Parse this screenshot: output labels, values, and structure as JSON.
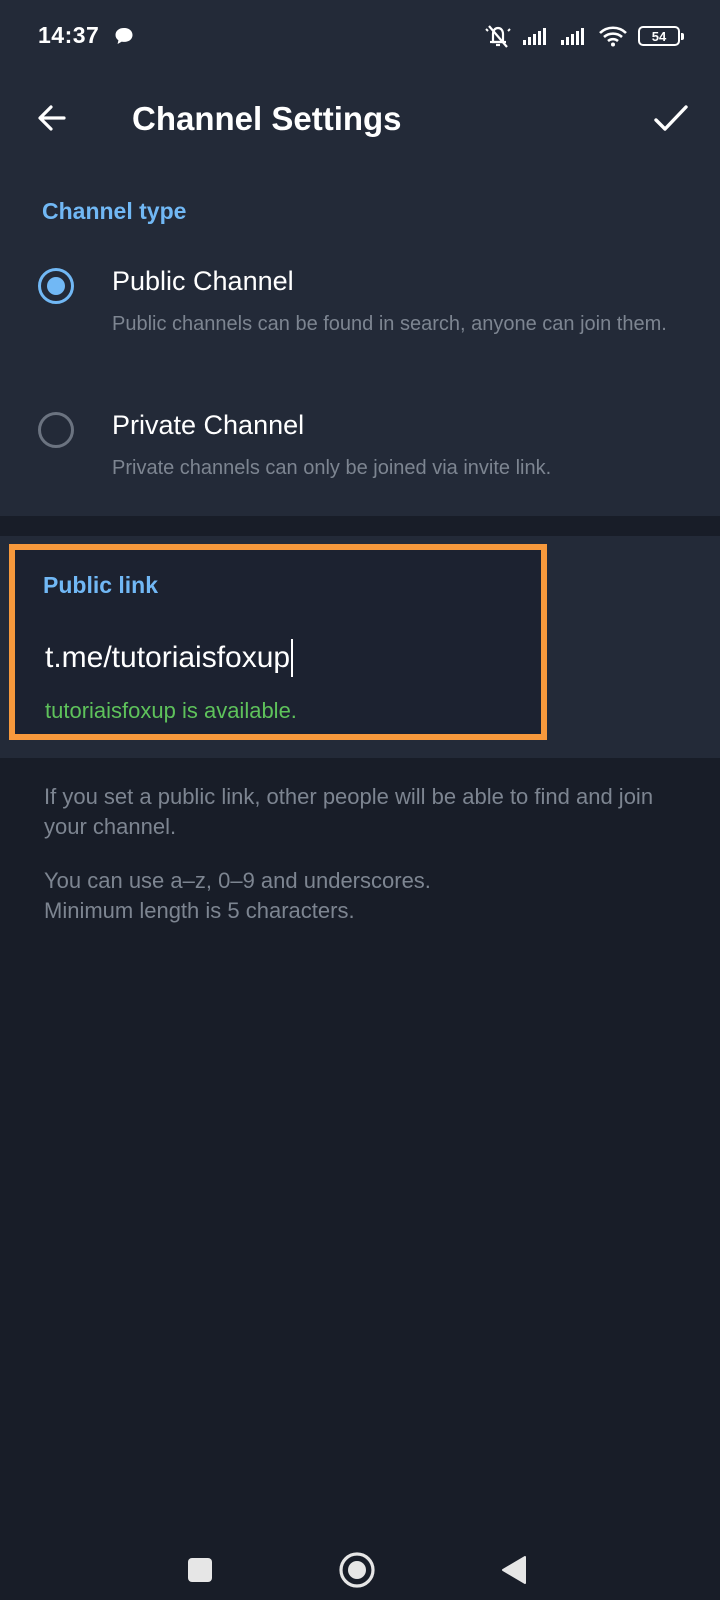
{
  "status_bar": {
    "time": "14:37",
    "battery": "54",
    "icons": [
      "chat-bubble-icon",
      "muted-bell-icon",
      "signal-icon",
      "signal-icon",
      "wifi-icon",
      "battery-icon"
    ]
  },
  "app_bar": {
    "title": "Channel Settings",
    "back_icon": "arrow-left-icon",
    "done_icon": "check-icon"
  },
  "channel_type": {
    "header": "Channel type",
    "options": [
      {
        "title": "Public Channel",
        "description": "Public channels can be found in search, anyone can join them.",
        "selected": true
      },
      {
        "title": "Private Channel",
        "description": "Private channels can only be joined via invite link.",
        "selected": false
      }
    ]
  },
  "public_link": {
    "header": "Public link",
    "value": "t.me/tutoriaisfoxup",
    "status": "tutoriaisfoxup is available."
  },
  "info": {
    "paragraph1": "If you set a public link, other people will be able to find and join your channel.",
    "paragraph2_line1": "You can use a–z, 0–9 and underscores.",
    "paragraph2_line2": "Minimum length is 5 characters."
  },
  "colors": {
    "accent": "#71b8f5",
    "highlight": "#f7993c",
    "success": "#5ec25b",
    "surface": "#232a38",
    "background": "#181d28"
  },
  "nav_bar": {
    "icons": [
      "square-icon",
      "circle-home-icon",
      "triangle-back-icon"
    ]
  }
}
